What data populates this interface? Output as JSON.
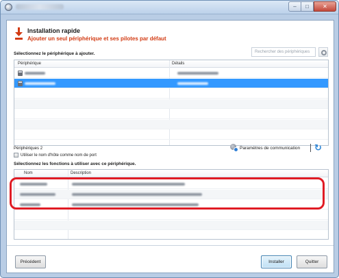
{
  "window": {
    "title": "",
    "controls": {
      "minimize": "–",
      "maximize": "□",
      "close": "✕"
    }
  },
  "header": {
    "title": "Installation rapide",
    "subtitle": "Ajouter un seul périphérique et ses pilotes par défaut",
    "icon": "download-arrow-icon",
    "accent_color": "#d23a12"
  },
  "device_section": {
    "label": "Sélectionnez le périphérique à ajouter.",
    "search_placeholder": "Rechercher des périphériques",
    "columns": [
      "Périphérique",
      "Détails"
    ],
    "rows": [
      {
        "name": "",
        "details": "",
        "selected": false
      },
      {
        "name": "",
        "details": "",
        "selected": true
      }
    ],
    "selection_color": "#3399ff"
  },
  "device_count": "Périphériques 2",
  "hostname_checkbox": {
    "label": "Utiliser le nom d'hôte comme nom de port",
    "checked": false
  },
  "communication": {
    "label": "Paramètres de communication",
    "icon": "network-settings-icon",
    "refresh_icon": "refresh-icon"
  },
  "functions_section": {
    "label": "Sélectionnez les fonctions à utiliser avec ce périphérique.",
    "columns": [
      "Nom",
      "Description"
    ],
    "rows": [
      {
        "name": "",
        "description": ""
      },
      {
        "name": "",
        "description": ""
      },
      {
        "name": "",
        "description": ""
      }
    ],
    "highlight_color": "#e01b24"
  },
  "footer": {
    "back_label": "Précédent",
    "install_label": "Installer",
    "quit_label": "Quitter"
  }
}
